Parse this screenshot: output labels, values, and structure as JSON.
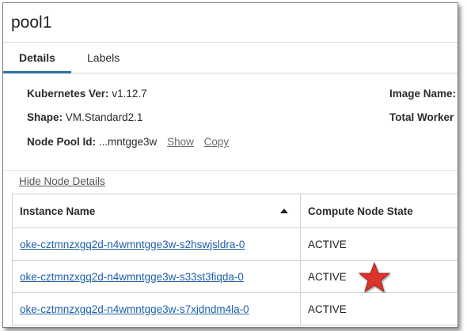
{
  "page": {
    "title": "pool1"
  },
  "tabs": [
    {
      "label": "Details",
      "active": true
    },
    {
      "label": "Labels",
      "active": false
    }
  ],
  "details": {
    "k8s_label": "Kubernetes Ver:",
    "k8s_value": "v1.12.7",
    "shape_label": "Shape:",
    "shape_value": "VM.Standard2.1",
    "nodepool_label": "Node Pool Id:",
    "nodepool_value": "...mntgge3w",
    "show_link": "Show",
    "copy_link": "Copy",
    "image_label": "Image Name:",
    "total_worker_label": "Total Worker"
  },
  "hide_node_details": "Hide Node Details",
  "table": {
    "columns": [
      "Instance Name",
      "Compute Node State"
    ],
    "rows": [
      {
        "name": "oke-cztmnzxgq2d-n4wmntgge3w-s2hswjsldra-0",
        "state": "ACTIVE"
      },
      {
        "name": "oke-cztmnzxgq2d-n4wmntgge3w-s33st3fiqda-0",
        "state": "ACTIVE"
      },
      {
        "name": "oke-cztmnzxgq2d-n4wmntgge3w-s7xjdndm4la-0",
        "state": "ACTIVE"
      }
    ]
  },
  "colors": {
    "accent": "#2e73a6",
    "link": "#1f5fa8",
    "star": "#d9352a"
  },
  "icons": {
    "sort": "sort-ascending-icon",
    "star": "star-icon"
  }
}
